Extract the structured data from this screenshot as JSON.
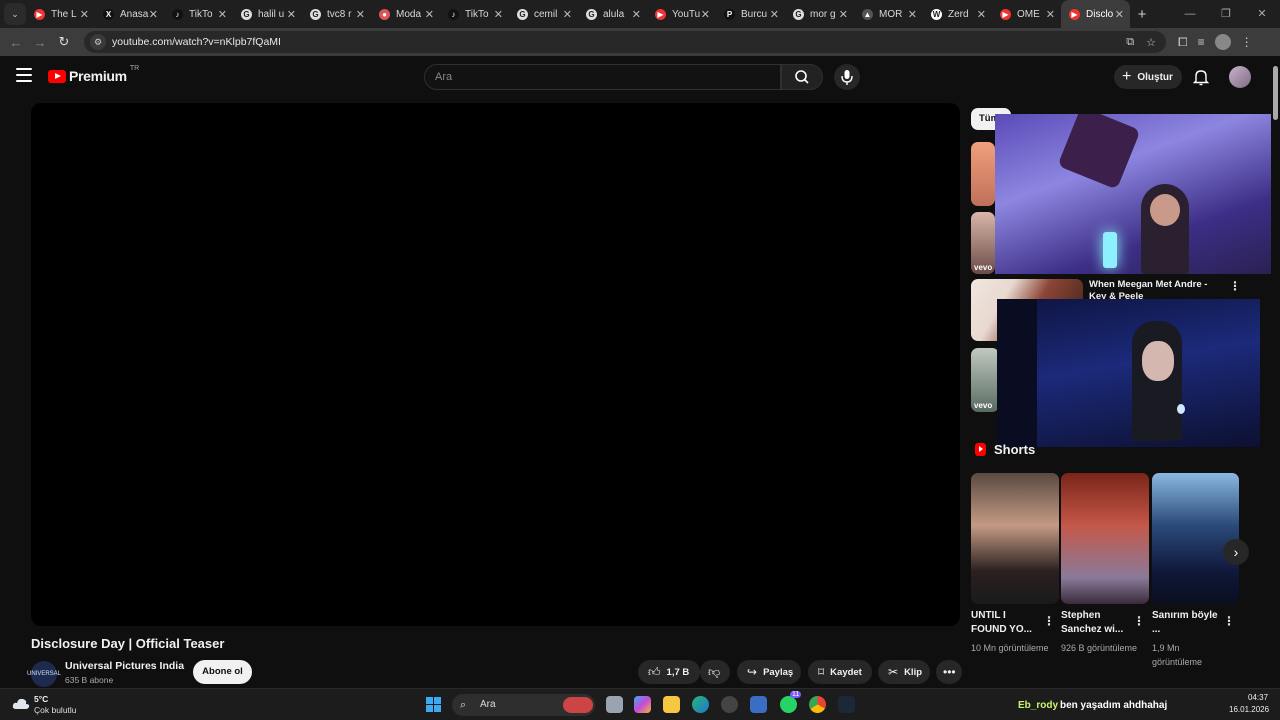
{
  "browser": {
    "tabs": [
      {
        "label": "The L",
        "fav": "#e33",
        "glyph": "▶"
      },
      {
        "label": "Anasa",
        "fav": "#111",
        "glyph": "X"
      },
      {
        "label": "TikTo",
        "fav": "#111",
        "glyph": "♪"
      },
      {
        "label": "halil u",
        "fav": "#ddd",
        "glyph": "G"
      },
      {
        "label": "tvc8 r",
        "fav": "#ddd",
        "glyph": "G"
      },
      {
        "label": "Moda",
        "fav": "#d55",
        "glyph": "●"
      },
      {
        "label": "TikTo",
        "fav": "#111",
        "glyph": "♪"
      },
      {
        "label": "cemil",
        "fav": "#ddd",
        "glyph": "G"
      },
      {
        "label": "alula",
        "fav": "#ddd",
        "glyph": "G"
      },
      {
        "label": "YouTu",
        "fav": "#e33",
        "glyph": "▶"
      },
      {
        "label": "Burcu",
        "fav": "#111",
        "glyph": "P"
      },
      {
        "label": "mor g",
        "fav": "#ddd",
        "glyph": "G"
      },
      {
        "label": "MOR",
        "fav": "#555",
        "glyph": "▲"
      },
      {
        "label": "Zerd",
        "fav": "#fff",
        "glyph": "W"
      },
      {
        "label": "OME",
        "fav": "#e33",
        "glyph": "▶"
      },
      {
        "label": "Disclo",
        "fav": "#e33",
        "glyph": "▶"
      }
    ],
    "url": "youtube.com/watch?v=nKlpb7fQaMI"
  },
  "header": {
    "logo_text": "Premium",
    "region": "TR",
    "search_placeholder": "Ara",
    "create_label": "Oluştur"
  },
  "video": {
    "title": "Disclosure Day | Official Teaser",
    "channel_name": "Universal Pictures India",
    "channel_logo_text": "UNIVERSAL",
    "subscribers": "635 B abone",
    "subscribe_label": "Abone ol",
    "likes": "1,7 B",
    "share_label": "Paylaş",
    "save_label": "Kaydet",
    "clip_label": "Klip"
  },
  "sidebar": {
    "chip_all": "Tüm",
    "rec_title": "When Meegan Met Andre - Key & Peele",
    "vevo_label": "vevo"
  },
  "shorts": {
    "heading": "Shorts",
    "items": [
      {
        "title": "UNTIL I FOUND YO...",
        "views": "10 Mn görüntüleme"
      },
      {
        "title": "Stephen Sanchez wi...",
        "views": "926 B görüntüleme"
      },
      {
        "title": "Sanırım böyle ...",
        "views": "1,9 Mn görüntüleme"
      }
    ]
  },
  "taskbar": {
    "temperature": "5°C",
    "weather": "Çok bulutlu",
    "search_label": "Ara",
    "time": "04:37",
    "date": "16.01.2026",
    "whatsapp_badge": "11"
  },
  "overlay_chat": {
    "user": "Eb_rody",
    "message": "ben yaşadım ahdhahaj"
  }
}
